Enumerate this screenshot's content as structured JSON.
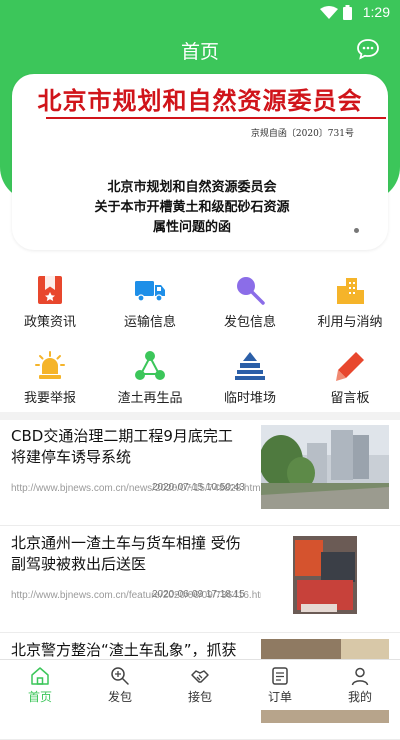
{
  "status_bar": {
    "time": "1:29"
  },
  "header": {
    "title": "首页",
    "chat_icon": "chat-bubble-icon"
  },
  "banner": {
    "org_heading": "北京市规划和自然资源委员会",
    "doc_number": "京规自函〔2020〕731号",
    "doc_title_lines": [
      "北京市规划和自然资源委员会",
      "关于本市开槽黄土和级配砂石资源",
      "属性问题的函"
    ]
  },
  "menu": [
    {
      "label": "政策资讯",
      "icon": "policy-bookmark-icon",
      "color": "#e8472d"
    },
    {
      "label": "运输信息",
      "icon": "truck-icon",
      "color": "#1e8fe8"
    },
    {
      "label": "发包信息",
      "icon": "shovel-icon",
      "color": "#8b6de8"
    },
    {
      "label": "利用与消纳",
      "icon": "factory-icon",
      "color": "#f5b42a"
    },
    {
      "label": "我要举报",
      "icon": "alarm-light-icon",
      "color": "#f5b42a"
    },
    {
      "label": "渣土再生品",
      "icon": "recycle-icon",
      "color": "#3cc65a"
    },
    {
      "label": "临时堆场",
      "icon": "stack-icon",
      "color": "#2b5fa8"
    },
    {
      "label": "留言板",
      "icon": "pencil-icon",
      "color": "#e8472d"
    }
  ],
  "news": [
    {
      "title": "CBD交通治理二期工程9月底完工 将建停车诱导系统",
      "source": "http://www.bjnews.com.cn/news/2020/07/15/748828.html",
      "date": "2020-07-15 10:50:43"
    },
    {
      "title": "北京通州一渣土车与货车相撞 受伤副驾驶被救出后送医",
      "source": "http://www.bjnews.com.cn/feature/2020/06/09/736416.html",
      "date": "2020-06-09 17:18:15"
    },
    {
      "title": "北京警方整治“渣土车乱象”，抓获",
      "source": "",
      "date": ""
    }
  ],
  "tabs": [
    {
      "label": "首页",
      "icon": "home-icon",
      "active": true
    },
    {
      "label": "发包",
      "icon": "publish-icon",
      "active": false
    },
    {
      "label": "接包",
      "icon": "handshake-icon",
      "active": false
    },
    {
      "label": "订单",
      "icon": "order-icon",
      "active": false
    },
    {
      "label": "我的",
      "icon": "profile-icon",
      "active": false
    }
  ],
  "colors": {
    "primary_green": "#3cc65a",
    "doc_red": "#d0141a"
  }
}
